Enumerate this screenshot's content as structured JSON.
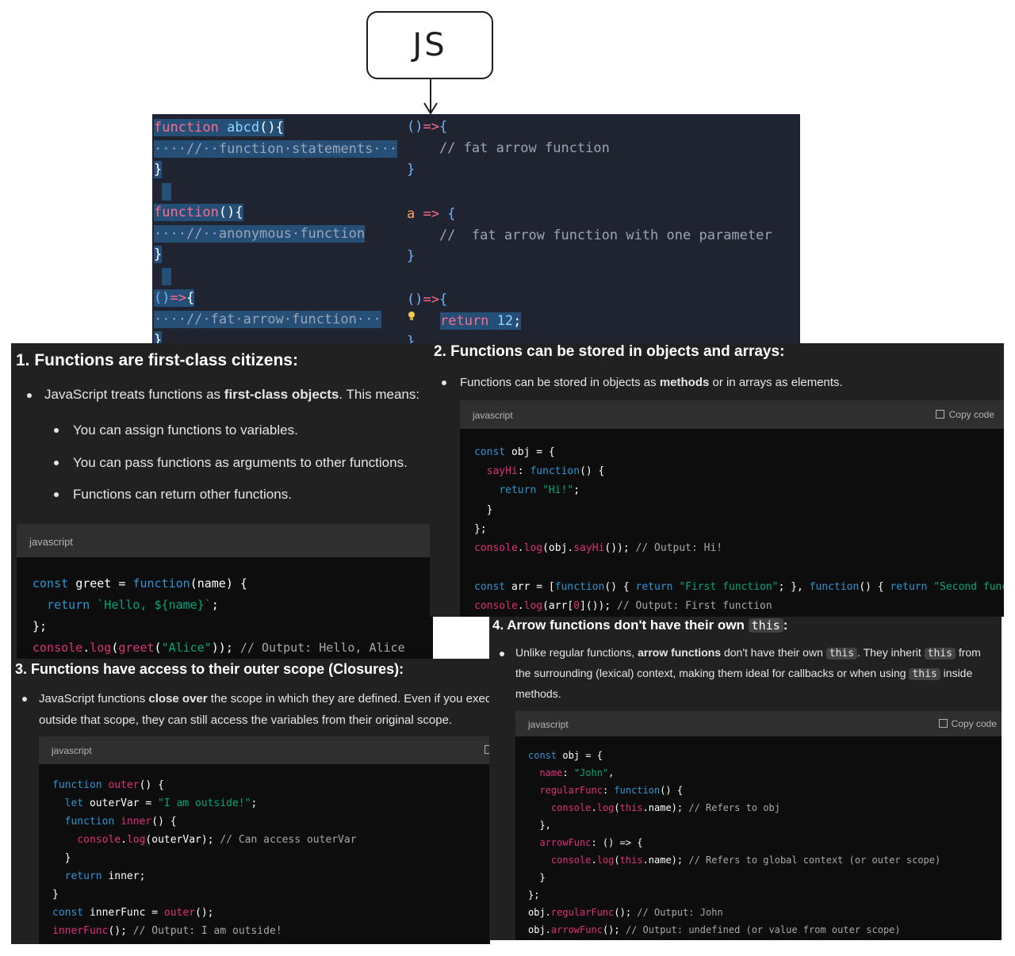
{
  "badge": {
    "label": "JS"
  },
  "editor": {
    "left": [
      "function abcd(){",
      "····//··function·statements···",
      "}",
      "function(){",
      "····//··anonymous·function",
      "}",
      "()=>{",
      "····//·fat·arrow·function···",
      "}"
    ],
    "right": [
      "()=>{",
      "    // fat arrow function",
      "}",
      "a => {",
      "    //  fat arrow function with one parameter",
      "}",
      "()=>{",
      "return 12;",
      "}"
    ]
  },
  "panel1": {
    "title": "1. Functions are first-class citizens:",
    "bullet_pre": "JavaScript treats functions as ",
    "bullet_bold": "first-class objects",
    "bullet_post": ". This means:",
    "sub": [
      "You can assign functions to variables.",
      "You can pass functions as arguments to other functions.",
      "Functions can return other functions."
    ],
    "code_lang": "javascript",
    "code": [
      "const greet = function(name) {",
      "  return `Hello, ${name}`;",
      "};",
      "console.log(greet(\"Alice\")); // Output: Hello, Alice"
    ]
  },
  "panel2": {
    "title": "2. Functions can be stored in objects and arrays:",
    "bullet_pre": "Functions can be stored in objects as ",
    "bullet_bold": "methods",
    "bullet_post": " or in arrays as elements.",
    "code_lang": "javascript",
    "copy_label": "Copy code",
    "code": [
      "const obj = {",
      "  sayHi: function() {",
      "    return \"Hi!\";",
      "  }",
      "};",
      "console.log(obj.sayHi()); // Output: Hi!",
      "",
      "const arr = [function() { return \"First function\"; }, function() { return \"Second func",
      "console.log(arr[0]()); // Output: First function"
    ]
  },
  "panel3": {
    "title": "3. Functions have access to their outer scope (Closures):",
    "line1_pre": "JavaScript functions ",
    "line1_bold": "close over",
    "line1_post": " the scope in which they are defined. Even if you exec",
    "line2": "outside that scope, they can still access the variables from their original scope.",
    "code_lang": "javascript",
    "code": [
      "function outer() {",
      "  let outerVar = \"I am outside!\";",
      "  function inner() {",
      "    console.log(outerVar); // Can access outerVar",
      "  }",
      "  return inner;",
      "}",
      "const innerFunc = outer();",
      "innerFunc(); // Output: I am outside!"
    ]
  },
  "panel4": {
    "title_pre": "4. Arrow functions don't have their own ",
    "title_code": "this",
    "title_post": ":",
    "l1_a": "Unlike regular functions, ",
    "l1_b": "arrow functions",
    "l1_c": " don't have their own ",
    "l1_code1": "this",
    "l1_d": ". They inherit ",
    "l1_code2": "this",
    "l1_e": " from",
    "l2_a": "the surrounding (lexical) context, making them ideal for callbacks or when using ",
    "l2_code": "this",
    "l2_b": " inside",
    "l3": "methods.",
    "code_lang": "javascript",
    "copy_label": "Copy code",
    "code": [
      "const obj = {",
      "  name: \"John\",",
      "  regularFunc: function() {",
      "    console.log(this.name); // Refers to obj",
      "  },",
      "  arrowFunc: () => {",
      "    console.log(this.name); // Refers to global context (or outer scope)",
      "  }",
      "};",
      "obj.regularFunc(); // Output: John",
      "obj.arrowFunc(); // Output: undefined (or value from outer scope)"
    ]
  },
  "colors": {
    "panel_bg": "#212121",
    "code_bg": "#0d0d0d",
    "editor_bg": "#1f2430",
    "selection": "#264f78"
  }
}
